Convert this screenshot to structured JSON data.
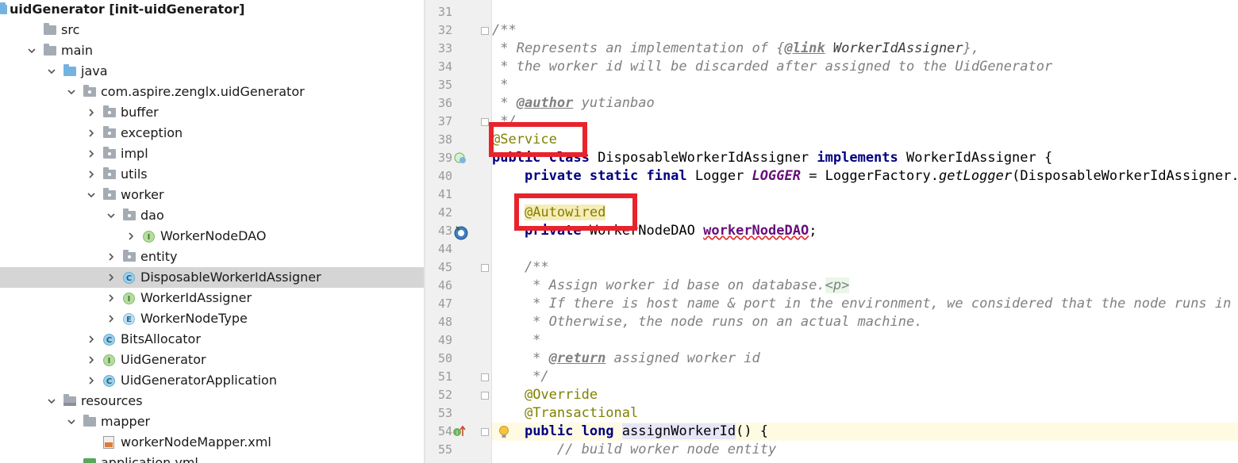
{
  "project_tree": {
    "items": [
      {
        "label": "uidGenerator",
        "suffix": " [init-uidGenerator]",
        "indent": 0,
        "arrow": "none",
        "icon": "module"
      },
      {
        "label": "src",
        "indent": 1,
        "arrow": "none",
        "icon": "folder"
      },
      {
        "label": "main",
        "indent": 1,
        "arrow": "expanded",
        "icon": "folder"
      },
      {
        "label": "java",
        "indent": 2,
        "arrow": "expanded",
        "icon": "source-folder"
      },
      {
        "label": "com.aspire.zenglx.uidGenerator",
        "indent": 3,
        "arrow": "expanded",
        "icon": "package"
      },
      {
        "label": "buffer",
        "indent": 4,
        "arrow": "collapsed",
        "icon": "package"
      },
      {
        "label": "exception",
        "indent": 4,
        "arrow": "collapsed",
        "icon": "package"
      },
      {
        "label": "impl",
        "indent": 4,
        "arrow": "collapsed",
        "icon": "package"
      },
      {
        "label": "utils",
        "indent": 4,
        "arrow": "collapsed",
        "icon": "package"
      },
      {
        "label": "worker",
        "indent": 4,
        "arrow": "expanded",
        "icon": "package"
      },
      {
        "label": "dao",
        "indent": 5,
        "arrow": "expanded",
        "icon": "package"
      },
      {
        "label": "WorkerNodeDAO",
        "indent": 6,
        "arrow": "collapsed",
        "icon": "interface"
      },
      {
        "label": "entity",
        "indent": 5,
        "arrow": "collapsed",
        "icon": "package"
      },
      {
        "label": "DisposableWorkerIdAssigner",
        "indent": 5,
        "arrow": "collapsed",
        "icon": "class",
        "selected": true
      },
      {
        "label": "WorkerIdAssigner",
        "indent": 5,
        "arrow": "collapsed",
        "icon": "interface"
      },
      {
        "label": "WorkerNodeType",
        "indent": 5,
        "arrow": "collapsed",
        "icon": "enum"
      },
      {
        "label": "BitsAllocator",
        "indent": 4,
        "arrow": "collapsed",
        "icon": "class"
      },
      {
        "label": "UidGenerator",
        "indent": 4,
        "arrow": "collapsed",
        "icon": "interface"
      },
      {
        "label": "UidGeneratorApplication",
        "indent": 4,
        "arrow": "collapsed",
        "icon": "spring-class"
      },
      {
        "label": "resources",
        "indent": 2,
        "arrow": "expanded",
        "icon": "resources-folder"
      },
      {
        "label": "mapper",
        "indent": 3,
        "arrow": "expanded",
        "icon": "folder"
      },
      {
        "label": "workerNodeMapper.xml",
        "indent": 4,
        "arrow": "none",
        "icon": "xml-file"
      },
      {
        "label": "application.yml",
        "indent": 3,
        "arrow": "none",
        "icon": "yml-file"
      }
    ]
  },
  "editor": {
    "current_line": "54",
    "lines": [
      {
        "num": "31",
        "segs": []
      },
      {
        "num": "32",
        "segs": [
          [
            "cm",
            "/**"
          ]
        ]
      },
      {
        "num": "33",
        "segs": [
          [
            "cm",
            " * Represents an implementation of {"
          ],
          [
            "tag",
            "@link"
          ],
          [
            "tagtext",
            " WorkerIdAssigner"
          ],
          [
            "cm",
            "},"
          ]
        ]
      },
      {
        "num": "34",
        "segs": [
          [
            "cm",
            " * the worker id will be discarded after assigned to the UidGenerator"
          ]
        ]
      },
      {
        "num": "35",
        "segs": [
          [
            "cm",
            " *"
          ]
        ]
      },
      {
        "num": "36",
        "segs": [
          [
            "cm",
            " * "
          ],
          [
            "tag",
            "@author"
          ],
          [
            "cm",
            " yutianbao"
          ]
        ]
      },
      {
        "num": "37",
        "segs": [
          [
            "cm",
            " */"
          ]
        ]
      },
      {
        "num": "38",
        "segs": [
          [
            "ann",
            "@Service"
          ]
        ]
      },
      {
        "num": "39",
        "segs": [
          [
            "kw",
            "public class"
          ],
          [
            "",
            " DisposableWorkerIdAssigner "
          ],
          [
            "kw",
            "implements"
          ],
          [
            "",
            " WorkerIdAssigner {"
          ]
        ]
      },
      {
        "num": "40",
        "segs": [
          [
            "",
            "    "
          ],
          [
            "kw",
            "private static final"
          ],
          [
            "",
            " Logger "
          ],
          [
            "cst",
            "LOGGER"
          ],
          [
            "",
            " = LoggerFactory."
          ],
          [
            "sm",
            "getLogger"
          ],
          [
            "",
            "(DisposableWorkerIdAssigner.class);"
          ]
        ]
      },
      {
        "num": "41",
        "segs": []
      },
      {
        "num": "42",
        "segs": [
          [
            "",
            "    "
          ],
          [
            "annhl",
            "@Autowired"
          ]
        ]
      },
      {
        "num": "43",
        "segs": [
          [
            "",
            "    "
          ],
          [
            "kw",
            "private"
          ],
          [
            "",
            " WorkerNodeDAO "
          ],
          [
            "fldsq",
            "workerNodeDAO"
          ],
          [
            "",
            ";"
          ]
        ]
      },
      {
        "num": "44",
        "segs": []
      },
      {
        "num": "45",
        "segs": [
          [
            "cm",
            "    /**"
          ]
        ]
      },
      {
        "num": "46",
        "segs": [
          [
            "cm",
            "     * Assign worker id base on database."
          ],
          [
            "ptag",
            "<p>"
          ]
        ]
      },
      {
        "num": "47",
        "segs": [
          [
            "cm",
            "     * If there is host name & port in the environment, we considered that the node runs in Docker container"
          ]
        ]
      },
      {
        "num": "48",
        "segs": [
          [
            "cm",
            "     * Otherwise, the node runs on an actual machine."
          ]
        ]
      },
      {
        "num": "49",
        "segs": [
          [
            "cm",
            "     *"
          ]
        ]
      },
      {
        "num": "50",
        "segs": [
          [
            "cm",
            "     * "
          ],
          [
            "tag",
            "@return"
          ],
          [
            "cm",
            " assigned worker id"
          ]
        ]
      },
      {
        "num": "51",
        "segs": [
          [
            "cm",
            "     */"
          ]
        ]
      },
      {
        "num": "52",
        "segs": [
          [
            "",
            "    "
          ],
          [
            "ann",
            "@Override"
          ]
        ]
      },
      {
        "num": "53",
        "segs": [
          [
            "",
            "    "
          ],
          [
            "ann",
            "@Transactional"
          ]
        ]
      },
      {
        "num": "54",
        "segs": [
          [
            "",
            "    "
          ],
          [
            "kw",
            "public long"
          ],
          [
            "",
            " "
          ],
          [
            "mhl",
            "assignWorkerId"
          ],
          [
            "",
            "() {"
          ]
        ]
      },
      {
        "num": "55",
        "segs": [
          [
            "cm",
            "        // build worker node entity"
          ]
        ]
      }
    ]
  },
  "gutter_icons": {
    "class_impl": "implemented-class-icon",
    "autowired": "spring-autowired-bean-icon",
    "method_impl": "implements-method-icon",
    "bulb": "intention-bulb-icon"
  },
  "colors": {
    "highlight_box": "#e8232c",
    "selected_row": "#d5d5d5",
    "keyword": "#000080",
    "annotation": "#808000",
    "comment": "#808080",
    "field": "#660e7a"
  }
}
